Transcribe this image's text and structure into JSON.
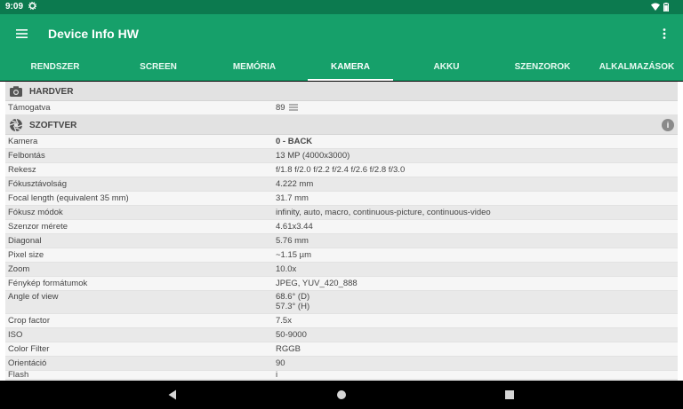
{
  "status": {
    "time": "9:09"
  },
  "app": {
    "title": "Device Info HW"
  },
  "tabs": [
    "RENDSZER",
    "SCREEN",
    "MEMÓRIA",
    "KAMERA",
    "AKKU",
    "SZENZOROK",
    "ALKALMAZÁSOK"
  ],
  "active_tab": "KAMERA",
  "hardver": {
    "label": "HARDVER",
    "rows": [
      {
        "k": "Támogatva",
        "v": "89"
      }
    ]
  },
  "szoftver": {
    "label": "SZOFTVER",
    "rows": [
      {
        "k": "Kamera",
        "v": "0 - BACK"
      },
      {
        "k": "Felbontás",
        "v": "13 MP (4000x3000)"
      },
      {
        "k": "Rekesz",
        "v": "f/1.8 f/2.0 f/2.2 f/2.4 f/2.6 f/2.8 f/3.0"
      },
      {
        "k": "Fókusztávolság",
        "v": "4.222 mm"
      },
      {
        "k": "Focal length (equivalent 35 mm)",
        "v": "31.7 mm"
      },
      {
        "k": "Fókusz módok",
        "v": "infinity, auto, macro, continuous-picture, continuous-video"
      },
      {
        "k": "Szenzor mérete",
        "v": "4.61x3.44"
      },
      {
        "k": "Diagonal",
        "v": "5.76 mm"
      },
      {
        "k": "Pixel size",
        "v": "~1.15 µm"
      },
      {
        "k": "Zoom",
        "v": "10.0x"
      },
      {
        "k": "Fénykép formátumok",
        "v": "JPEG, YUV_420_888"
      },
      {
        "k": "Angle of view",
        "v": "68.6° (D)",
        "v2": "57.3° (H)"
      },
      {
        "k": "Crop factor",
        "v": "7.5x"
      },
      {
        "k": "ISO",
        "v": "50-9000"
      },
      {
        "k": "Color Filter",
        "v": "RGGB"
      },
      {
        "k": "Orientáció",
        "v": "90"
      },
      {
        "k": "Flash",
        "v": "i"
      }
    ]
  },
  "icons": {
    "gear": "gear-icon",
    "wifi": "wifi-icon",
    "battery": "battery-icon",
    "menu": "menu-icon",
    "overflow": "more-vert-icon",
    "camera": "camera-icon",
    "aperture": "aperture-icon",
    "info": "info-icon",
    "list": "list-icon"
  },
  "colors": {
    "status_bar": "#0c7a4f",
    "app_bar": "#16a06a",
    "section": "#e2e2e2"
  }
}
